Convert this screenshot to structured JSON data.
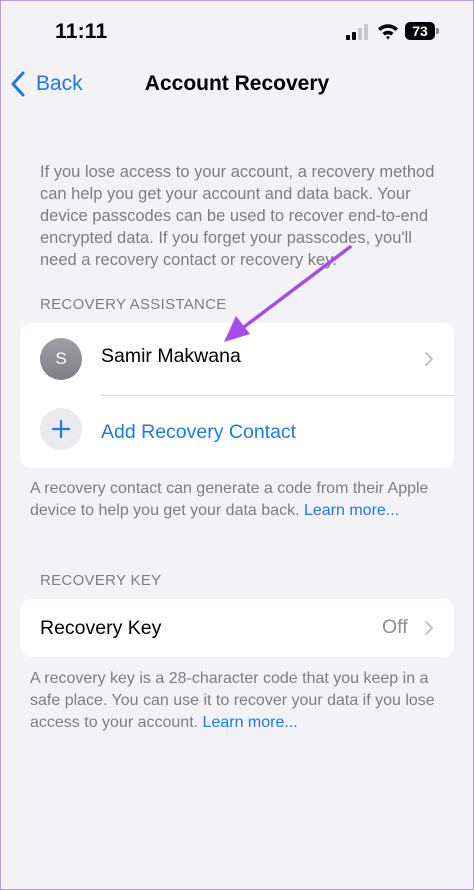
{
  "status_bar": {
    "time": "11:11",
    "battery_level": "73",
    "icons": [
      "signal-icon",
      "wifi-icon",
      "battery-icon"
    ]
  },
  "nav": {
    "back_label": "Back",
    "title": "Account Recovery"
  },
  "intro_text": "If you lose access to your account, a recovery method can help you get your account and data back. Your device passcodes can be used to recover end-to-end encrypted data. If you forget your passcodes, you'll need a recovery contact or recovery key.",
  "recovery_assistance": {
    "header": "RECOVERY ASSISTANCE",
    "contact": {
      "initial": "S",
      "name": "Samir Makwana"
    },
    "add_contact_label": "Add Recovery Contact",
    "footer_text": "A recovery contact can generate a code from their Apple device to help you get your data back.",
    "footer_link": "Learn more..."
  },
  "recovery_key": {
    "header": "RECOVERY KEY",
    "label": "Recovery Key",
    "value": "Off",
    "footer_text": "A recovery key is a 28-character code that you keep in a safe place. You can use it to recover your data if you lose access to your account.",
    "footer_link": "Learn more..."
  },
  "colors": {
    "accent": "#1F7AE0",
    "background": "#F2F2F7",
    "secondary_text": "#7D7D82",
    "annotation_arrow": "#A64CEB"
  }
}
